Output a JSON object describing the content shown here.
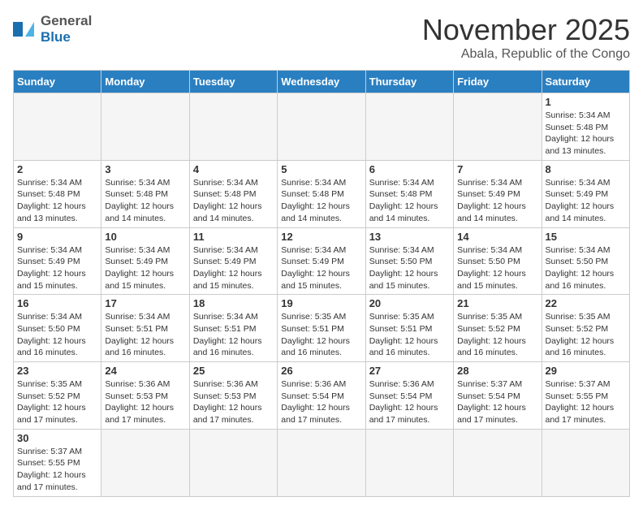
{
  "logo": {
    "line1": "General",
    "line2": "Blue"
  },
  "title": "November 2025",
  "location": "Abala, Republic of the Congo",
  "weekdays": [
    "Sunday",
    "Monday",
    "Tuesday",
    "Wednesday",
    "Thursday",
    "Friday",
    "Saturday"
  ],
  "weeks": [
    [
      {
        "day": "",
        "empty": true
      },
      {
        "day": "",
        "empty": true
      },
      {
        "day": "",
        "empty": true
      },
      {
        "day": "",
        "empty": true
      },
      {
        "day": "",
        "empty": true
      },
      {
        "day": "",
        "empty": true
      },
      {
        "day": "1",
        "info": "Sunrise: 5:34 AM\nSunset: 5:48 PM\nDaylight: 12 hours and 13 minutes."
      }
    ],
    [
      {
        "day": "2",
        "info": "Sunrise: 5:34 AM\nSunset: 5:48 PM\nDaylight: 12 hours and 13 minutes."
      },
      {
        "day": "3",
        "info": "Sunrise: 5:34 AM\nSunset: 5:48 PM\nDaylight: 12 hours and 14 minutes."
      },
      {
        "day": "4",
        "info": "Sunrise: 5:34 AM\nSunset: 5:48 PM\nDaylight: 12 hours and 14 minutes."
      },
      {
        "day": "5",
        "info": "Sunrise: 5:34 AM\nSunset: 5:48 PM\nDaylight: 12 hours and 14 minutes."
      },
      {
        "day": "6",
        "info": "Sunrise: 5:34 AM\nSunset: 5:48 PM\nDaylight: 12 hours and 14 minutes."
      },
      {
        "day": "7",
        "info": "Sunrise: 5:34 AM\nSunset: 5:49 PM\nDaylight: 12 hours and 14 minutes."
      },
      {
        "day": "8",
        "info": "Sunrise: 5:34 AM\nSunset: 5:49 PM\nDaylight: 12 hours and 14 minutes."
      }
    ],
    [
      {
        "day": "9",
        "info": "Sunrise: 5:34 AM\nSunset: 5:49 PM\nDaylight: 12 hours and 15 minutes."
      },
      {
        "day": "10",
        "info": "Sunrise: 5:34 AM\nSunset: 5:49 PM\nDaylight: 12 hours and 15 minutes."
      },
      {
        "day": "11",
        "info": "Sunrise: 5:34 AM\nSunset: 5:49 PM\nDaylight: 12 hours and 15 minutes."
      },
      {
        "day": "12",
        "info": "Sunrise: 5:34 AM\nSunset: 5:49 PM\nDaylight: 12 hours and 15 minutes."
      },
      {
        "day": "13",
        "info": "Sunrise: 5:34 AM\nSunset: 5:50 PM\nDaylight: 12 hours and 15 minutes."
      },
      {
        "day": "14",
        "info": "Sunrise: 5:34 AM\nSunset: 5:50 PM\nDaylight: 12 hours and 15 minutes."
      },
      {
        "day": "15",
        "info": "Sunrise: 5:34 AM\nSunset: 5:50 PM\nDaylight: 12 hours and 16 minutes."
      }
    ],
    [
      {
        "day": "16",
        "info": "Sunrise: 5:34 AM\nSunset: 5:50 PM\nDaylight: 12 hours and 16 minutes."
      },
      {
        "day": "17",
        "info": "Sunrise: 5:34 AM\nSunset: 5:51 PM\nDaylight: 12 hours and 16 minutes."
      },
      {
        "day": "18",
        "info": "Sunrise: 5:34 AM\nSunset: 5:51 PM\nDaylight: 12 hours and 16 minutes."
      },
      {
        "day": "19",
        "info": "Sunrise: 5:35 AM\nSunset: 5:51 PM\nDaylight: 12 hours and 16 minutes."
      },
      {
        "day": "20",
        "info": "Sunrise: 5:35 AM\nSunset: 5:51 PM\nDaylight: 12 hours and 16 minutes."
      },
      {
        "day": "21",
        "info": "Sunrise: 5:35 AM\nSunset: 5:52 PM\nDaylight: 12 hours and 16 minutes."
      },
      {
        "day": "22",
        "info": "Sunrise: 5:35 AM\nSunset: 5:52 PM\nDaylight: 12 hours and 16 minutes."
      }
    ],
    [
      {
        "day": "23",
        "info": "Sunrise: 5:35 AM\nSunset: 5:52 PM\nDaylight: 12 hours and 17 minutes."
      },
      {
        "day": "24",
        "info": "Sunrise: 5:36 AM\nSunset: 5:53 PM\nDaylight: 12 hours and 17 minutes."
      },
      {
        "day": "25",
        "info": "Sunrise: 5:36 AM\nSunset: 5:53 PM\nDaylight: 12 hours and 17 minutes."
      },
      {
        "day": "26",
        "info": "Sunrise: 5:36 AM\nSunset: 5:54 PM\nDaylight: 12 hours and 17 minutes."
      },
      {
        "day": "27",
        "info": "Sunrise: 5:36 AM\nSunset: 5:54 PM\nDaylight: 12 hours and 17 minutes."
      },
      {
        "day": "28",
        "info": "Sunrise: 5:37 AM\nSunset: 5:54 PM\nDaylight: 12 hours and 17 minutes."
      },
      {
        "day": "29",
        "info": "Sunrise: 5:37 AM\nSunset: 5:55 PM\nDaylight: 12 hours and 17 minutes."
      }
    ],
    [
      {
        "day": "30",
        "info": "Sunrise: 5:37 AM\nSunset: 5:55 PM\nDaylight: 12 hours and 17 minutes."
      },
      {
        "day": "",
        "empty": true
      },
      {
        "day": "",
        "empty": true
      },
      {
        "day": "",
        "empty": true
      },
      {
        "day": "",
        "empty": true
      },
      {
        "day": "",
        "empty": true
      },
      {
        "day": "",
        "empty": true
      }
    ]
  ]
}
